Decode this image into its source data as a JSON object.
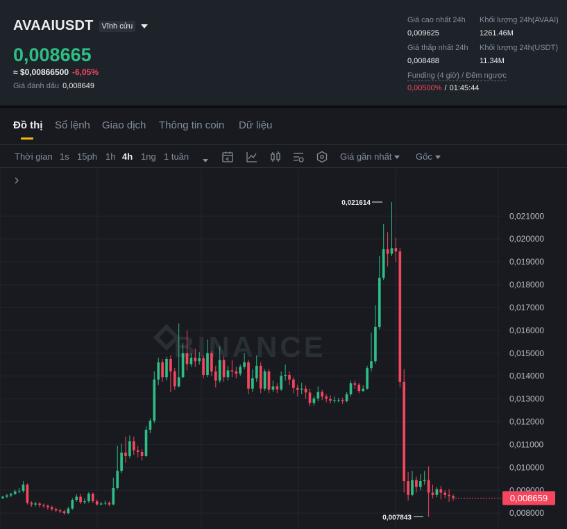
{
  "header": {
    "symbol": "AVAAIUSDT",
    "contract_type": "Vĩnh cửu",
    "last_price": "0,008665",
    "usd_price": "≈ $0,00866500",
    "change_pct": "-6,05%",
    "mark_label": "Giá đánh dấu",
    "mark_value": "0,008649",
    "high_label": "Giá cao nhất 24h",
    "high_value": "0,009625",
    "low_label": "Giá thấp nhất 24h",
    "low_value": "0,008488",
    "vol_base_label": "Khối lượng 24h(AVAAI)",
    "vol_base_value": "1261.46M",
    "vol_quote_label": "Khối lượng 24h(USDT)",
    "vol_quote_value": "11.34M",
    "funding_label": "Funding (4 giờ) / Đếm ngược",
    "funding_rate": "0,00500%",
    "funding_sep": "/",
    "countdown": "01:45:44"
  },
  "tabs": [
    "Đồ thị",
    "Sổ lệnh",
    "Giao dịch",
    "Thông tin coin",
    "Dữ liệu"
  ],
  "toolbar": {
    "time_label": "Thời gian",
    "intervals": [
      "1s",
      "15ph",
      "1h",
      "4h",
      "1ng",
      "1 tuần"
    ],
    "active_interval": "4h",
    "price_type": "Giá gần nhất",
    "origin": "Gốc",
    "icons": [
      "calendar-icon",
      "indicator-icon",
      "candle-type-icon",
      "chart-settings-icon",
      "depth-icon"
    ]
  },
  "colors": {
    "up": "#2ebd85",
    "down": "#f6465d",
    "accent": "#f0b90b",
    "background": "#181a20"
  },
  "chart_data": {
    "type": "candlestick",
    "y_ticks": [
      "0,021000",
      "0,020000",
      "0,019000",
      "0,018000",
      "0,017000",
      "0,016000",
      "0,015000",
      "0,014000",
      "0,013000",
      "0,012000",
      "0,011000",
      "0,010000",
      "0,009000",
      "0,008000"
    ],
    "ylim": [
      0.00755,
      0.0228
    ],
    "high_marker": "0,021614",
    "low_marker": "0,007843",
    "current_price": "0,008659",
    "watermark": "BINANCE",
    "candles": [
      [
        0.00865,
        0.00872,
        0.00862,
        0.00875
      ],
      [
        0.00872,
        0.00878,
        0.00866,
        0.00884
      ],
      [
        0.00878,
        0.00884,
        0.0087,
        0.0089
      ],
      [
        0.00884,
        0.00895,
        0.0088,
        0.00902
      ],
      [
        0.00895,
        0.00898,
        0.00886,
        0.0091
      ],
      [
        0.00898,
        0.00925,
        0.0089,
        0.0094
      ],
      [
        0.00925,
        0.00845,
        0.00838,
        0.0093
      ],
      [
        0.00845,
        0.00838,
        0.00828,
        0.00852
      ],
      [
        0.00838,
        0.00842,
        0.0083,
        0.0085
      ],
      [
        0.00842,
        0.00836,
        0.00825,
        0.00848
      ],
      [
        0.00836,
        0.00832,
        0.00822,
        0.00842
      ],
      [
        0.00832,
        0.00826,
        0.00815,
        0.00838
      ],
      [
        0.00826,
        0.00818,
        0.0081,
        0.00832
      ],
      [
        0.00818,
        0.00812,
        0.00805,
        0.00826
      ],
      [
        0.00812,
        0.00808,
        0.008,
        0.0082
      ],
      [
        0.00808,
        0.008,
        0.00793,
        0.00815
      ],
      [
        0.008,
        0.0082,
        0.00795,
        0.00828
      ],
      [
        0.0082,
        0.00858,
        0.00815,
        0.00865
      ],
      [
        0.00858,
        0.00872,
        0.0085,
        0.00882
      ],
      [
        0.00872,
        0.00848,
        0.0084,
        0.00885
      ],
      [
        0.00848,
        0.00852,
        0.0084,
        0.00865
      ],
      [
        0.00852,
        0.00885,
        0.00845,
        0.00892
      ],
      [
        0.00885,
        0.00852,
        0.00845,
        0.0089
      ],
      [
        0.00852,
        0.00838,
        0.00832,
        0.0086
      ],
      [
        0.00838,
        0.00842,
        0.00834,
        0.0085
      ],
      [
        0.00842,
        0.00845,
        0.00835,
        0.00855
      ],
      [
        0.00845,
        0.00838,
        0.0083,
        0.00852
      ],
      [
        0.00838,
        0.0091,
        0.00835,
        0.00955
      ],
      [
        0.0091,
        0.00985,
        0.00905,
        0.01095
      ],
      [
        0.00985,
        0.01065,
        0.00975,
        0.01105
      ],
      [
        0.01065,
        0.0105,
        0.0102,
        0.01135
      ],
      [
        0.0105,
        0.01115,
        0.0104,
        0.0114
      ],
      [
        0.01115,
        0.01075,
        0.01055,
        0.01135
      ],
      [
        0.01075,
        0.01068,
        0.01045,
        0.01095
      ],
      [
        0.01068,
        0.0105,
        0.0103,
        0.0108
      ],
      [
        0.0105,
        0.01165,
        0.01045,
        0.0118
      ],
      [
        0.01165,
        0.01205,
        0.0115,
        0.01215
      ],
      [
        0.01205,
        0.01385,
        0.01195,
        0.0142
      ],
      [
        0.01385,
        0.0146,
        0.0136,
        0.0148
      ],
      [
        0.0146,
        0.01395,
        0.01375,
        0.01475
      ],
      [
        0.01395,
        0.01475,
        0.0138,
        0.01485
      ],
      [
        0.01475,
        0.0142,
        0.0133,
        0.0149
      ],
      [
        0.0142,
        0.01355,
        0.0134,
        0.01435
      ],
      [
        0.01355,
        0.01395,
        0.0135,
        0.0163
      ],
      [
        0.01395,
        0.015,
        0.0139,
        0.01545
      ],
      [
        0.015,
        0.01452,
        0.01425,
        0.016
      ],
      [
        0.01452,
        0.0148,
        0.0144,
        0.015
      ],
      [
        0.0148,
        0.01465,
        0.0144,
        0.0152
      ],
      [
        0.01465,
        0.01478,
        0.0145,
        0.01505
      ],
      [
        0.01478,
        0.01405,
        0.0139,
        0.0149
      ],
      [
        0.01405,
        0.015,
        0.01395,
        0.0156
      ],
      [
        0.015,
        0.0142,
        0.014,
        0.0151
      ],
      [
        0.0142,
        0.0138,
        0.0135,
        0.01445
      ],
      [
        0.0138,
        0.0147,
        0.0137,
        0.0153
      ],
      [
        0.0147,
        0.01395,
        0.01375,
        0.01485
      ],
      [
        0.01395,
        0.01425,
        0.0138,
        0.01445
      ],
      [
        0.01425,
        0.0142,
        0.01395,
        0.0147
      ],
      [
        0.0142,
        0.0141,
        0.0139,
        0.0144
      ],
      [
        0.0141,
        0.0144,
        0.014,
        0.0145
      ],
      [
        0.0144,
        0.0146,
        0.0143,
        0.015
      ],
      [
        0.0146,
        0.01345,
        0.0132,
        0.0147
      ],
      [
        0.01345,
        0.0139,
        0.0133,
        0.0143
      ],
      [
        0.0139,
        0.01445,
        0.01375,
        0.0149
      ],
      [
        0.01445,
        0.01345,
        0.01325,
        0.0146
      ],
      [
        0.01345,
        0.0142,
        0.01335,
        0.0143
      ],
      [
        0.0142,
        0.0134,
        0.01325,
        0.0143
      ],
      [
        0.0134,
        0.01355,
        0.0133,
        0.0138
      ],
      [
        0.01355,
        0.01342,
        0.01325,
        0.01368
      ],
      [
        0.01342,
        0.014,
        0.01335,
        0.0142
      ],
      [
        0.014,
        0.01405,
        0.0138,
        0.0145
      ],
      [
        0.01405,
        0.01385,
        0.0136,
        0.0142
      ],
      [
        0.01385,
        0.01348,
        0.01325,
        0.01395
      ],
      [
        0.01348,
        0.0134,
        0.0131,
        0.01362
      ],
      [
        0.0134,
        0.01345,
        0.0132,
        0.0137
      ],
      [
        0.01345,
        0.01328,
        0.013,
        0.01358
      ],
      [
        0.01328,
        0.01282,
        0.01268,
        0.01345
      ],
      [
        0.01282,
        0.01302,
        0.0127,
        0.01312
      ],
      [
        0.01302,
        0.0133,
        0.0129,
        0.01355
      ],
      [
        0.0133,
        0.0131,
        0.01295,
        0.0134
      ],
      [
        0.0131,
        0.013,
        0.01285,
        0.0132
      ],
      [
        0.013,
        0.01292,
        0.0128,
        0.01315
      ],
      [
        0.01292,
        0.01295,
        0.01282,
        0.0131
      ],
      [
        0.01295,
        0.01295,
        0.01285,
        0.01305
      ],
      [
        0.01295,
        0.0129,
        0.01278,
        0.01305
      ],
      [
        0.0129,
        0.0132,
        0.01285,
        0.0133
      ],
      [
        0.0132,
        0.01368,
        0.0131,
        0.0138
      ],
      [
        0.01368,
        0.01362,
        0.01345,
        0.0138
      ],
      [
        0.01362,
        0.01335,
        0.01325,
        0.0137
      ],
      [
        0.01335,
        0.01345,
        0.0133,
        0.0136
      ],
      [
        0.01345,
        0.01435,
        0.0134,
        0.01445
      ],
      [
        0.01435,
        0.01465,
        0.0142,
        0.0159
      ],
      [
        0.01465,
        0.01615,
        0.01455,
        0.0171
      ],
      [
        0.01615,
        0.0183,
        0.01605,
        0.01925
      ],
      [
        0.0183,
        0.01955,
        0.0182,
        0.02065
      ],
      [
        0.01955,
        0.01935,
        0.0188,
        0.0203
      ],
      [
        0.01935,
        0.0196,
        0.01925,
        0.02161
      ],
      [
        0.0196,
        0.01945,
        0.019,
        0.02005
      ],
      [
        0.01945,
        0.01375,
        0.0135,
        0.0196
      ],
      [
        0.01375,
        0.0094,
        0.0089,
        0.0143
      ],
      [
        0.0094,
        0.0088,
        0.00855,
        0.0098
      ],
      [
        0.0088,
        0.00945,
        0.00875,
        0.00985
      ],
      [
        0.00945,
        0.00915,
        0.0089,
        0.0096
      ],
      [
        0.00915,
        0.0094,
        0.009,
        0.0097
      ],
      [
        0.0094,
        0.00945,
        0.00925,
        0.00985
      ],
      [
        0.00945,
        0.0089,
        0.00784,
        0.01005
      ],
      [
        0.0089,
        0.0088,
        0.00865,
        0.00925
      ],
      [
        0.0088,
        0.00905,
        0.0087,
        0.00915
      ],
      [
        0.00905,
        0.0089,
        0.0086,
        0.0092
      ],
      [
        0.0089,
        0.0088,
        0.00865,
        0.009
      ],
      [
        0.0088,
        0.00875,
        0.0085,
        0.00905
      ],
      [
        0.00875,
        0.00866,
        0.00855,
        0.00882
      ]
    ]
  }
}
